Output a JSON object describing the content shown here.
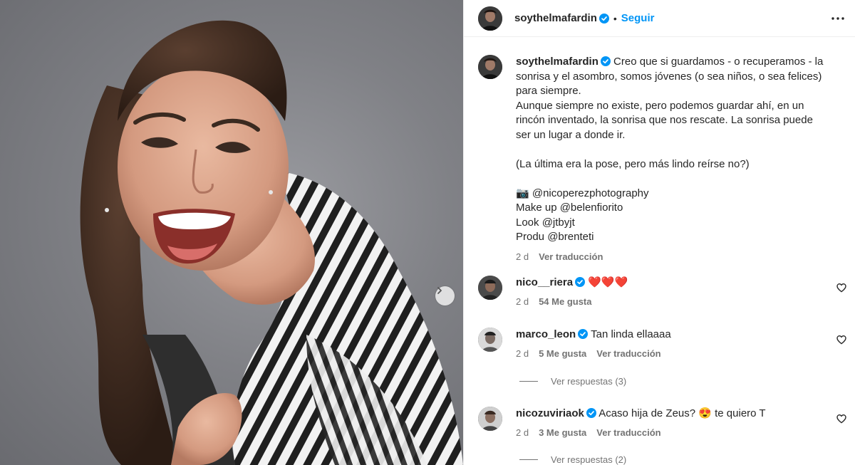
{
  "post": {
    "username": "soythelmafardin",
    "follow_label": "Seguir",
    "caption_lines": [
      "Creo que si guardamos - o recuperamos - la sonrisa y el asombro, somos jóvenes (o sea niños, o sea felices) para siempre.",
      "Aunque siempre no existe, pero podemos guardar ahí, en un rincón inventado, la sonrisa que nos rescate. La sonrisa puede ser un lugar a donde ir.",
      "",
      "(La última era la pose, pero más lindo reírse no?)",
      "",
      "📷 @nicoperezphotography",
      "Make up @belenfiorito",
      "Look @jtbyjt",
      "Produ @brenteti"
    ],
    "caption_time": "2 d",
    "caption_translate": "Ver traducción"
  },
  "comments": [
    {
      "username": "nico__riera",
      "text": "❤️❤️❤️",
      "time": "2 d",
      "likes": "54 Me gusta",
      "translate": ""
    },
    {
      "username": "marco_leon",
      "text": "Tan linda ellaaaa",
      "time": "2 d",
      "likes": "5 Me gusta",
      "translate": "Ver traducción",
      "replies": "Ver respuestas (3)"
    },
    {
      "username": "nicozuviriaok",
      "text": "Acaso hija de Zeus? 😍 te quiero T",
      "time": "2 d",
      "likes": "3 Me gusta",
      "translate": "Ver traducción",
      "replies": "Ver respuestas (2)"
    }
  ],
  "icons": {
    "verified": "verified-badge-icon",
    "more": "more-options-icon",
    "heart": "heart-outline-icon",
    "next": "chevron-right-icon"
  },
  "colors": {
    "accent": "#0095f6",
    "secondary_text": "#737373",
    "background": "#ffffff"
  }
}
